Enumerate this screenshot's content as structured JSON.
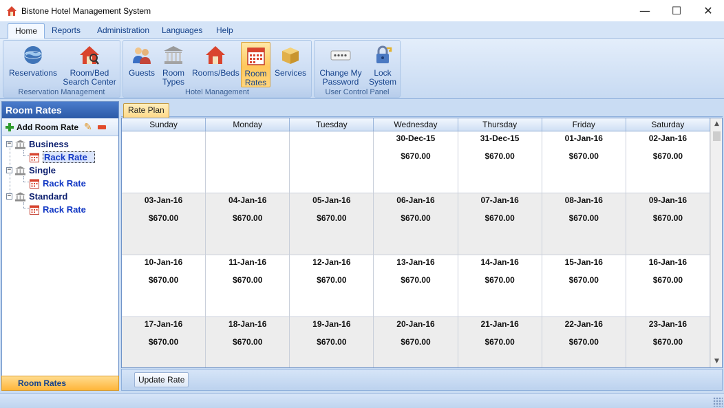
{
  "window": {
    "title": "Bistone Hotel Management System",
    "minimize": "—",
    "maximize": "☐",
    "close": "✕"
  },
  "menu": [
    "Home",
    "Reports",
    "Administration",
    "Languages",
    "Help"
  ],
  "ribbon": {
    "groups": [
      {
        "label": "Reservation Management",
        "buttons": [
          {
            "label": "Reservations",
            "icon": "globe-icon"
          },
          {
            "label": "Room/Bed Search Center",
            "icon": "house-search-icon"
          }
        ]
      },
      {
        "label": "Hotel Management",
        "buttons": [
          {
            "label": "Guests",
            "icon": "people-icon"
          },
          {
            "label": "Room Types",
            "icon": "building-icon"
          },
          {
            "label": "Rooms/Beds",
            "icon": "house-icon"
          },
          {
            "label": "Room Rates",
            "icon": "calendar-icon"
          },
          {
            "label": "Services",
            "icon": "box-icon"
          }
        ]
      },
      {
        "label": "User Control Panel",
        "buttons": [
          {
            "label": "Change My Password",
            "icon": "password-icon"
          },
          {
            "label": "Lock System",
            "icon": "lock-icon"
          }
        ]
      }
    ],
    "active_button": "Room Rates"
  },
  "left_panel": {
    "title": "Room Rates",
    "add_label": "Add Room Rate",
    "tree": [
      {
        "label": "Business",
        "children": [
          "Rack Rate"
        ]
      },
      {
        "label": "Single",
        "children": [
          "Rack Rate"
        ]
      },
      {
        "label": "Standard",
        "children": [
          "Rack Rate"
        ]
      }
    ],
    "selected_child": "Rack Rate",
    "footer": "Room Rates"
  },
  "main": {
    "tab": "Rate Plan",
    "days": [
      "Sunday",
      "Monday",
      "Tuesday",
      "Wednesday",
      "Thursday",
      "Friday",
      "Saturday"
    ],
    "weeks": [
      [
        null,
        null,
        null,
        {
          "date": "30-Dec-15",
          "price": "$670.00"
        },
        {
          "date": "31-Dec-15",
          "price": "$670.00"
        },
        {
          "date": "01-Jan-16",
          "price": "$670.00"
        },
        {
          "date": "02-Jan-16",
          "price": "$670.00"
        }
      ],
      [
        {
          "date": "03-Jan-16",
          "price": "$670.00"
        },
        {
          "date": "04-Jan-16",
          "price": "$670.00"
        },
        {
          "date": "05-Jan-16",
          "price": "$670.00"
        },
        {
          "date": "06-Jan-16",
          "price": "$670.00"
        },
        {
          "date": "07-Jan-16",
          "price": "$670.00"
        },
        {
          "date": "08-Jan-16",
          "price": "$670.00"
        },
        {
          "date": "09-Jan-16",
          "price": "$670.00"
        }
      ],
      [
        {
          "date": "10-Jan-16",
          "price": "$670.00"
        },
        {
          "date": "11-Jan-16",
          "price": "$670.00"
        },
        {
          "date": "12-Jan-16",
          "price": "$670.00"
        },
        {
          "date": "13-Jan-16",
          "price": "$670.00"
        },
        {
          "date": "14-Jan-16",
          "price": "$670.00"
        },
        {
          "date": "15-Jan-16",
          "price": "$670.00"
        },
        {
          "date": "16-Jan-16",
          "price": "$670.00"
        }
      ],
      [
        {
          "date": "17-Jan-16",
          "price": "$670.00"
        },
        {
          "date": "18-Jan-16",
          "price": "$670.00"
        },
        {
          "date": "19-Jan-16",
          "price": "$670.00"
        },
        {
          "date": "20-Jan-16",
          "price": "$670.00"
        },
        {
          "date": "21-Jan-16",
          "price": "$670.00"
        },
        {
          "date": "22-Jan-16",
          "price": "$670.00"
        },
        {
          "date": "23-Jan-16",
          "price": "$670.00"
        }
      ]
    ],
    "update_button": "Update Rate",
    "scroll_up": "▲",
    "scroll_down": "▼"
  }
}
